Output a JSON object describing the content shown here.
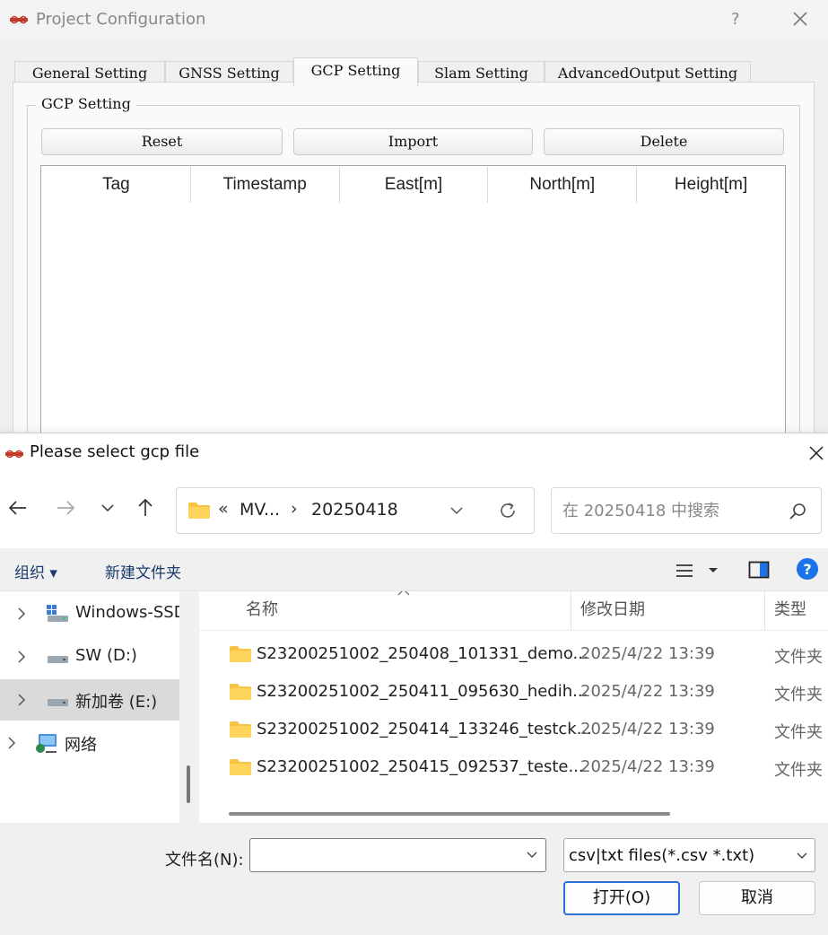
{
  "project_window": {
    "title": "Project Configuration",
    "help_glyph": "?",
    "tabs": [
      {
        "label": "General Setting"
      },
      {
        "label": "GNSS Setting"
      },
      {
        "label": "GCP Setting"
      },
      {
        "label": "Slam Setting"
      },
      {
        "label": "AdvancedOutput Setting"
      }
    ],
    "active_tab": "GCP Setting",
    "group_label": "GCP Setting",
    "buttons": {
      "reset": "Reset",
      "import": "Import",
      "delete": "Delete"
    },
    "table_headers": [
      "Tag",
      "Timestamp",
      "East[m]",
      "North[m]",
      "Height[m]"
    ]
  },
  "file_dialog": {
    "title": "Please select gcp file",
    "address": {
      "overflow": "«",
      "segment_1": "MV...",
      "separator": "›",
      "segment_2": "20250418"
    },
    "search_placeholder": "在 20250418 中搜索",
    "command_bar": {
      "organize": "组织 ▾",
      "new_folder": "新建文件夹"
    },
    "tree": [
      {
        "label": "Windows-SSD",
        "selected": false
      },
      {
        "label": "SW (D:)",
        "selected": false
      },
      {
        "label": "新加卷 (E:)",
        "selected": true
      },
      {
        "label": "网络",
        "selected": false
      }
    ],
    "columns": {
      "name": "名称",
      "date": "修改日期",
      "type": "类型"
    },
    "rows": [
      {
        "name": "S23200251002_250408_101331_demo...",
        "date": "2025/4/22 13:39",
        "type": "文件夹"
      },
      {
        "name": "S23200251002_250411_095630_hedih...",
        "date": "2025/4/22 13:39",
        "type": "文件夹"
      },
      {
        "name": "S23200251002_250414_133246_testck...",
        "date": "2025/4/22 13:39",
        "type": "文件夹"
      },
      {
        "name": "S23200251002_250415_092537_teste...",
        "date": "2025/4/22 13:39",
        "type": "文件夹"
      }
    ],
    "file_name_label": "文件名(N):",
    "file_name_value": "",
    "filter": "csv|txt files(*.csv *.txt)",
    "open_button": "打开(O)",
    "cancel_button": "取消",
    "colors": {
      "accent": "#2a6fd6",
      "folder": "#f6c343",
      "help": "#1a73e8"
    }
  }
}
